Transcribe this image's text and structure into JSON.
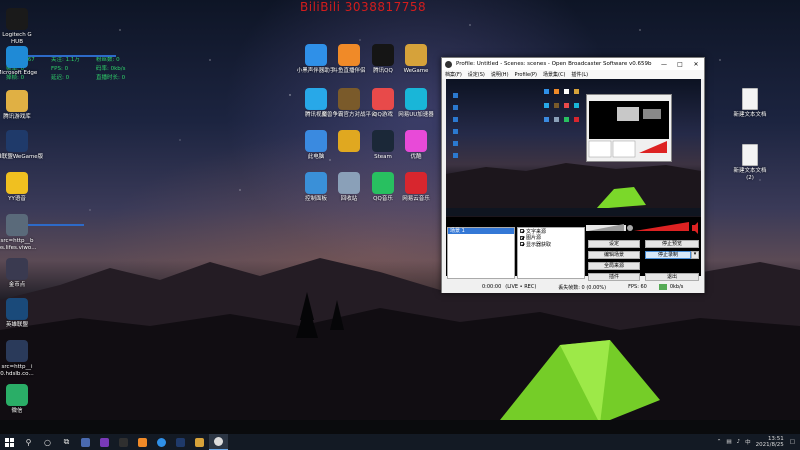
{
  "watermark": "BiliBili 3038817758",
  "network_monitor": {
    "row1": [
      "上传: 1.5KB/s",
      "下载: 0 B/s"
    ],
    "row2": [
      "CPU: 5267",
      "关注: 1.1万",
      "粉丝数: 0"
    ],
    "row3": [
      "帧率: 0",
      "FPS: 0",
      "码率: 0kb/s"
    ],
    "row4": [
      "掉帧: 0",
      "延迟: 0",
      "直播时长: 0"
    ]
  },
  "desktop_left_icons": [
    {
      "label": "Logitech G\nHUB",
      "icon": "logitech-g-icon",
      "color": "#1a1a1a"
    },
    {
      "label": "Microsoft Edge",
      "icon": "edge-icon",
      "color": "#1f8ad6"
    },
    {
      "label": "腾讯游戏库",
      "icon": "folder-icon",
      "color": "#e0b044"
    },
    {
      "label": "英雄联盟WeGame版",
      "icon": "lol-icon",
      "color": "#1f3a6a"
    },
    {
      "label": "YY语音",
      "icon": "yy-icon",
      "color": "#f0c020"
    },
    {
      "label": "src=http__b\nbs.lifes.viwo...",
      "icon": "image-file-icon",
      "color": "#5a6a7a"
    },
    {
      "label": "金币点",
      "icon": "image-file-icon",
      "color": "#3a3a50"
    },
    {
      "label": "英雄联盟",
      "icon": "lol-icon",
      "color": "#1a4a7a"
    },
    {
      "label": "src=http__i\n0.hdslb.co...",
      "icon": "image-file-icon",
      "color": "#2a3a5a"
    },
    {
      "label": "微信",
      "icon": "wechat-icon",
      "color": "#2aae67"
    }
  ],
  "desktop_mid_icons": [
    {
      "label": "小黑声伴器助手",
      "icon": "app-icon",
      "color": "#2f90e8"
    },
    {
      "label": "斗鱼直播伴侣",
      "icon": "douyu-icon",
      "color": "#f08a28"
    },
    {
      "label": "腾讯QQ",
      "icon": "qq-icon",
      "color": "#151515"
    },
    {
      "label": "WeGame",
      "icon": "wegame-icon",
      "color": "#d6a23a"
    },
    {
      "label": "腾讯视频",
      "icon": "tencent-video-icon",
      "color": "#28a8e8"
    },
    {
      "label": "魔兽争霸官方对战平台",
      "icon": "warcraft-icon",
      "color": "#7a5a2a"
    },
    {
      "label": "QQ游戏",
      "icon": "qq-game-icon",
      "color": "#e84a4a"
    },
    {
      "label": "网易UU加速器",
      "icon": "uu-icon",
      "color": "#19b6d8"
    },
    {
      "label": "此电脑",
      "icon": "computer-icon",
      "color": "#3a8ae0"
    },
    {
      "label": "",
      "icon": "folder-icon",
      "color": "#e0a820"
    },
    {
      "label": "Steam",
      "icon": "steam-icon",
      "color": "#1b2838"
    },
    {
      "label": "优酷",
      "icon": "youku-icon",
      "color": "#e84ad8"
    },
    {
      "label": "控制面板",
      "icon": "control-panel-icon",
      "color": "#3a90d8"
    },
    {
      "label": "回收站",
      "icon": "recycle-bin-icon",
      "color": "#8aa0b8"
    },
    {
      "label": "QQ音乐",
      "icon": "qq-music-icon",
      "color": "#28c060"
    },
    {
      "label": "网易云音乐",
      "icon": "netease-music-icon",
      "color": "#d8262e"
    }
  ],
  "desktop_right_icons": [
    {
      "label": "新建文本文档",
      "icon": "text-file-icon"
    },
    {
      "label": "新建文本文档\n(2)",
      "icon": "text-file-icon"
    }
  ],
  "obs": {
    "title": "Profile: Untitled - Scenes: scenes - Open Broadcaster Software v0.659b",
    "menu": [
      "档案(F)",
      "设定(S)",
      "说明(H)",
      "Profile(P)",
      "场景集(C)",
      "插件(L)"
    ],
    "scenes_title": "场景:",
    "scenes": [
      "场景 1"
    ],
    "sources_title": "来源:",
    "sources": [
      "文字来源",
      "图片源",
      "显示器获取"
    ],
    "buttons": {
      "settings": "设定",
      "stop_preview": "停止预览",
      "edit_scene": "编辑场景",
      "stop_recording": "停止录制",
      "global_sources": "全局来源",
      "plugins": "插件",
      "exit": "退出"
    },
    "status": {
      "time": "0:00:00",
      "live": "(LIVE • REC)",
      "dropped": "丢失帧数: 0 (0.00%)",
      "fps": "FPS: 60",
      "bitrate": "0kb/s"
    }
  },
  "taskbar": {
    "time": "13:51",
    "date": "2021/8/25"
  }
}
